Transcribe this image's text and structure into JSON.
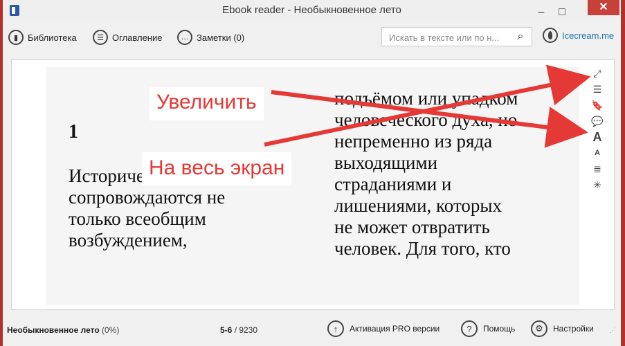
{
  "window": {
    "title": "Ebook reader - Необыкновенное лето",
    "min_icon": "–",
    "max_icon": "□",
    "close_icon": "✕"
  },
  "toolbar": {
    "library_label": "Библиотека",
    "contents_label": "Оглавление",
    "notes_label": "Заметки (0)",
    "search_placeholder": "Искать в тексте или по н...",
    "brand_label": "Icecream.me"
  },
  "book": {
    "chapter": "1",
    "left_lines": [
      "Исторические события",
      "сопровождаются не",
      "только всеобщим",
      "возбуждением,"
    ],
    "right_lines": [
      "подъёмом или упадком",
      "человеческого духа, но",
      "непременно из ряда",
      "выходящими",
      "страданиями и",
      "лишениями, которых",
      "не может отвратить",
      "человек. Для того, кто"
    ]
  },
  "annotations": {
    "zoom_label": "Увеличить",
    "fullscreen_label": "На весь экран",
    "color": "#e53935"
  },
  "side_tools": {
    "fullscreen": "⤢",
    "contents": "☰",
    "bookmark": "🔖",
    "notes": "💬",
    "font_up": "A",
    "font_down": "A",
    "text_layout": "≣",
    "brightness": "✳"
  },
  "status": {
    "book_title": "Необыкновенное лето",
    "progress": "(0%)",
    "current_pages": "5-6",
    "total_pages": "/ 9230",
    "pro_label": "Активация PRO версии",
    "help_label": "Помощь",
    "settings_label": "Настройки"
  }
}
